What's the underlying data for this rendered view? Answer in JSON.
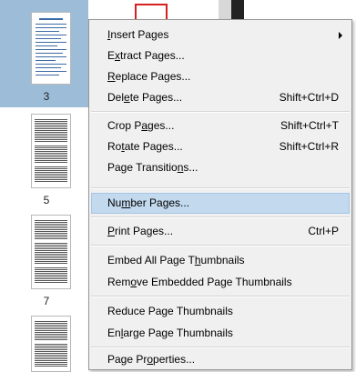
{
  "thumbnails": {
    "page_numbers": [
      "3",
      "5",
      "7"
    ]
  },
  "menu": {
    "items": [
      {
        "pre": "",
        "u": "I",
        "post": "nsert Pages",
        "shortcut": "",
        "submenu": true
      },
      {
        "pre": "E",
        "u": "x",
        "post": "tract Pages...",
        "shortcut": ""
      },
      {
        "pre": "",
        "u": "R",
        "post": "eplace Pages...",
        "shortcut": ""
      },
      {
        "pre": "Del",
        "u": "e",
        "post": "te Pages...",
        "shortcut": "Shift+Ctrl+D"
      },
      {
        "pre": "Crop P",
        "u": "a",
        "post": "ges...",
        "shortcut": "Shift+Ctrl+T"
      },
      {
        "pre": "Ro",
        "u": "t",
        "post": "ate Pages...",
        "shortcut": "Shift+Ctrl+R"
      },
      {
        "pre": "Page Transitio",
        "u": "n",
        "post": "s...",
        "shortcut": ""
      },
      {
        "pre": "Nu",
        "u": "m",
        "post": "ber Pages...",
        "shortcut": "",
        "highlighted": true
      },
      {
        "pre": "",
        "u": "P",
        "post": "rint Pages...",
        "shortcut": "Ctrl+P"
      },
      {
        "pre": "Embed All Page T",
        "u": "h",
        "post": "umbnails",
        "shortcut": ""
      },
      {
        "pre": "Rem",
        "u": "o",
        "post": "ve Embedded Page Thumbnails",
        "shortcut": ""
      },
      {
        "pre": "Reduce Page Thumbnails",
        "u": "",
        "post": "",
        "shortcut": ""
      },
      {
        "pre": "En",
        "u": "l",
        "post": "arge Page Thumbnails",
        "shortcut": ""
      },
      {
        "pre": "Page Pr",
        "u": "o",
        "post": "perties...",
        "shortcut": ""
      }
    ]
  }
}
